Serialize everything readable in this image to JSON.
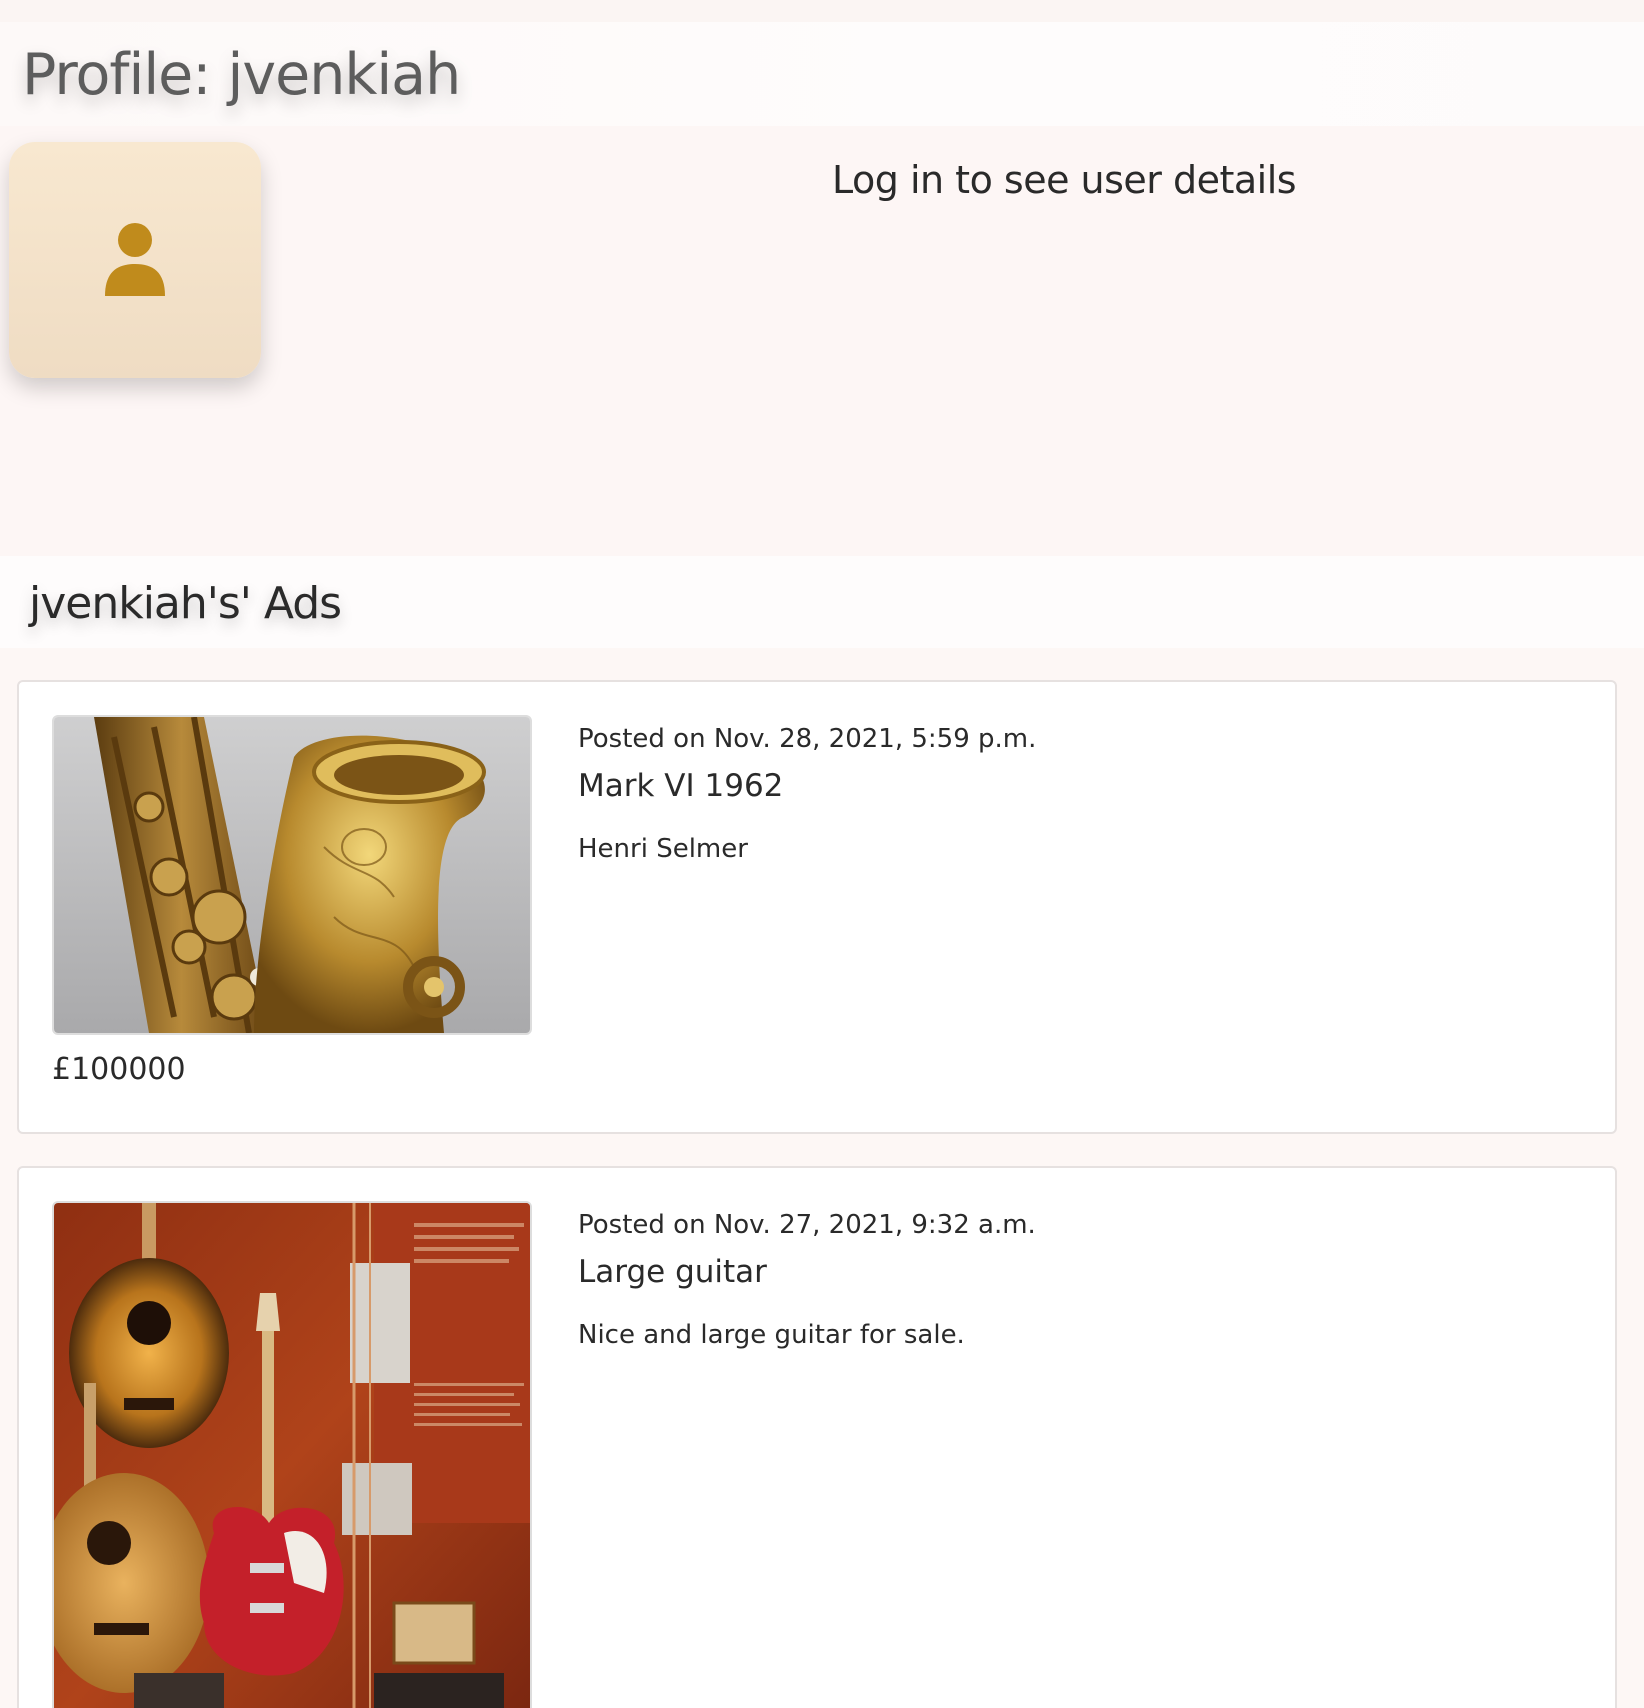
{
  "profile": {
    "title": "Profile: jvenkiah",
    "login_message": "Log in to see user details",
    "avatar_icon": "person-icon",
    "accent_color": "#c08b1c"
  },
  "ads_section": {
    "heading": "jvenkiah's' Ads",
    "ads": [
      {
        "posted": "Posted on Nov. 28, 2021, 5:59 p.m.",
        "title": "Mark VI 1962",
        "description": "Henri Selmer",
        "price": "£100000",
        "image_subject": "saxophone-photo"
      },
      {
        "posted": "Posted on Nov. 27, 2021, 9:32 a.m.",
        "title": "Large guitar",
        "description": "Nice and large guitar for sale.",
        "price": "",
        "image_subject": "guitar-photo"
      }
    ]
  }
}
